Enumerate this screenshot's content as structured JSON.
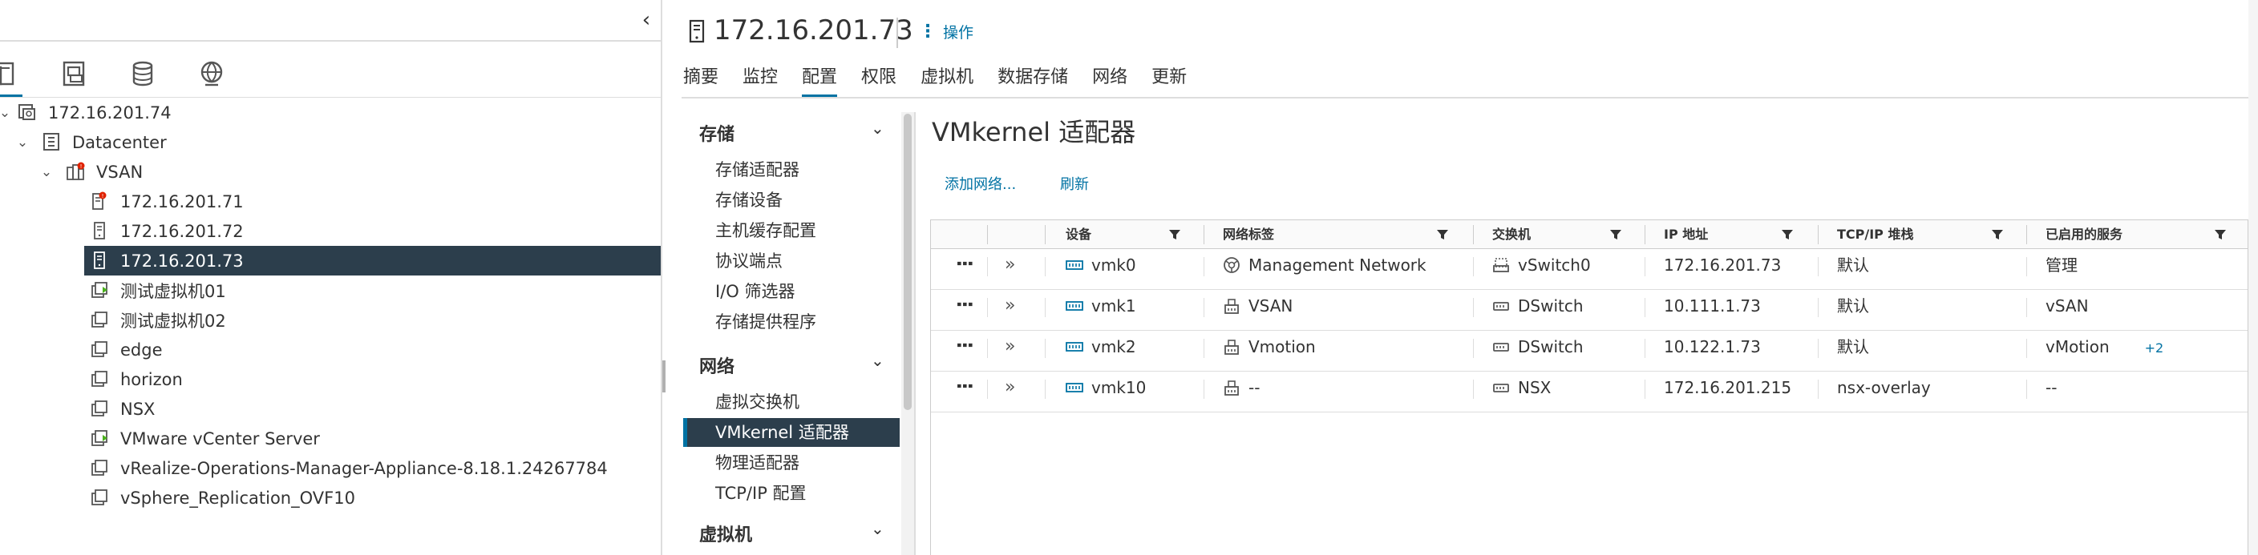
{
  "tree": {
    "collapse_glyph": "‹",
    "tabs": [
      {
        "icon": "hosts-clusters-icon"
      },
      {
        "icon": "vms-templates-icon"
      },
      {
        "icon": "storage-icon"
      },
      {
        "icon": "networking-icon"
      }
    ],
    "items": [
      {
        "label": "172.16.201.74",
        "icon": "vcenter-icon"
      },
      {
        "label": "Datacenter",
        "icon": "datacenter-icon"
      },
      {
        "label": "VSAN",
        "icon": "cluster-icon"
      },
      {
        "label": "172.16.201.71",
        "icon": "host-alert-icon"
      },
      {
        "label": "172.16.201.72",
        "icon": "host-icon"
      },
      {
        "label": "172.16.201.73",
        "icon": "host-icon"
      },
      {
        "label": "测试虚拟机01",
        "icon": "vm-on-icon"
      },
      {
        "label": "测试虚拟机02",
        "icon": "vm-icon"
      },
      {
        "label": "edge",
        "icon": "vm-icon"
      },
      {
        "label": "horizon",
        "icon": "vm-icon"
      },
      {
        "label": "NSX",
        "icon": "vm-icon"
      },
      {
        "label": "VMware vCenter Server",
        "icon": "vm-on-icon"
      },
      {
        "label": "vRealize-Operations-Manager-Appliance-8.18.1.24267784",
        "icon": "vm-icon"
      },
      {
        "label": "vSphere_Replication_OVF10",
        "icon": "vm-icon"
      }
    ]
  },
  "header": {
    "title": "172.16.201.73",
    "actions_label": "操作"
  },
  "tabs": [
    "摘要",
    "监控",
    "配置",
    "权限",
    "虚拟机",
    "数据存储",
    "网络",
    "更新"
  ],
  "config_nav": {
    "groups": [
      {
        "label": "存储",
        "items": [
          "存储适配器",
          "存储设备",
          "主机缓存配置",
          "协议端点",
          "I/O 筛选器",
          "存储提供程序"
        ]
      },
      {
        "label": "网络",
        "items": [
          "虚拟交换机",
          "VMkernel 适配器",
          "物理适配器",
          "TCP/IP 配置"
        ]
      },
      {
        "label": "虚拟机",
        "items": []
      }
    ]
  },
  "content": {
    "title": "VMkernel 适配器",
    "add_network_label": "添加网络...",
    "refresh_label": "刷新",
    "columns": [
      "设备",
      "网络标签",
      "交换机",
      "IP 地址",
      "TCP/IP 堆栈",
      "已启用的服务"
    ],
    "rows": [
      {
        "device": "vmk0",
        "network": "Management Network",
        "network_icon": "portgroup-icon",
        "switch": "vSwitch0",
        "switch_icon": "standard-switch-icon",
        "ip": "172.16.201.73",
        "stack": "默认",
        "services": "管理",
        "more": ""
      },
      {
        "device": "vmk1",
        "network": "VSAN",
        "network_icon": "dvportgroup-icon",
        "switch": "DSwitch",
        "switch_icon": "distributed-switch-icon",
        "ip": "10.111.1.73",
        "stack": "默认",
        "services": "vSAN",
        "more": ""
      },
      {
        "device": "vmk2",
        "network": "Vmotion",
        "network_icon": "dvportgroup-icon",
        "switch": "DSwitch",
        "switch_icon": "distributed-switch-icon",
        "ip": "10.122.1.73",
        "stack": "默认",
        "services": "vMotion",
        "more": "+2"
      },
      {
        "device": "vmk10",
        "network": "--",
        "network_icon": "dvportgroup-icon",
        "switch": "NSX",
        "switch_icon": "distributed-switch-icon",
        "ip": "172.16.201.215",
        "stack": "nsx-overlay",
        "services": "--",
        "more": ""
      }
    ]
  },
  "colors": {
    "accent": "#0072a3",
    "selected_bg": "#2c3e4c",
    "alert": "#e02200",
    "vm_on": "#4aaf1c"
  }
}
